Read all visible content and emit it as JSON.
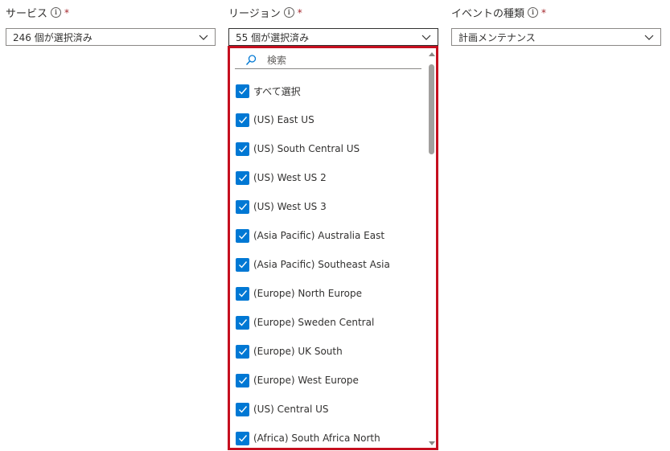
{
  "fields": {
    "service": {
      "label": "サービス",
      "required_mark": "*",
      "value": "246 個が選択済み"
    },
    "region": {
      "label": "リージョン",
      "required_mark": "*",
      "value": "55 個が選択済み"
    },
    "event_type": {
      "label": "イベントの種類",
      "required_mark": "*",
      "value": "計画メンテナンス"
    }
  },
  "dropdown": {
    "search_placeholder": "検索",
    "options": [
      {
        "label": "すべて選択",
        "checked": true
      },
      {
        "label": "(US) East US",
        "checked": true
      },
      {
        "label": "(US) South Central US",
        "checked": true
      },
      {
        "label": "(US) West US 2",
        "checked": true
      },
      {
        "label": "(US) West US 3",
        "checked": true
      },
      {
        "label": "(Asia Pacific) Australia East",
        "checked": true
      },
      {
        "label": "(Asia Pacific) Southeast Asia",
        "checked": true
      },
      {
        "label": "(Europe) North Europe",
        "checked": true
      },
      {
        "label": "(Europe) Sweden Central",
        "checked": true
      },
      {
        "label": "(Europe) UK South",
        "checked": true
      },
      {
        "label": "(Europe) West Europe",
        "checked": true
      },
      {
        "label": "(US) Central US",
        "checked": true
      },
      {
        "label": "(Africa) South Africa North",
        "checked": true
      }
    ]
  },
  "colors": {
    "checkbox": "#0078d4",
    "highlight_border": "#c50f1f",
    "required": "#a4262c"
  }
}
